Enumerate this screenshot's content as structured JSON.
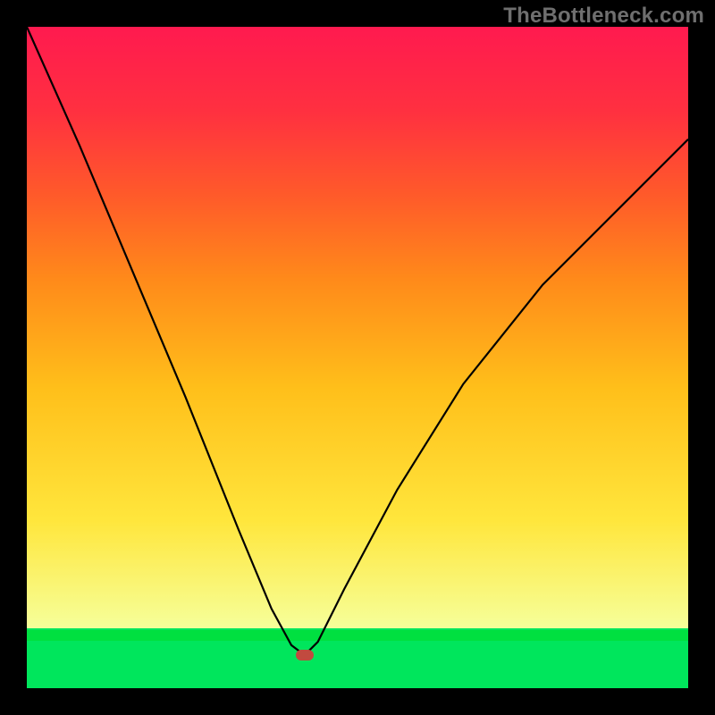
{
  "attribution": "TheBottleneck.com",
  "chart_data": {
    "type": "line",
    "title": "",
    "xlabel": "",
    "ylabel": "",
    "xlim": [
      0,
      100
    ],
    "ylim": [
      0,
      100
    ],
    "grid": false,
    "gradient_bands": {
      "lime_top": 93,
      "green_band_center": 92,
      "gradient_bottom": 91
    },
    "vertex": {
      "x": 42,
      "y": 95
    },
    "series": [
      {
        "name": "curve",
        "x": [
          0,
          8,
          16,
          24,
          32,
          37,
          40,
          42,
          44,
          48,
          56,
          66,
          78,
          90,
          100
        ],
        "values": [
          0,
          18,
          37,
          56,
          76,
          88,
          93.5,
          95,
          93,
          85,
          70,
          54,
          39,
          27,
          17
        ]
      }
    ],
    "marker": {
      "x": 42,
      "y": 95,
      "color": "#c14a3f"
    }
  }
}
